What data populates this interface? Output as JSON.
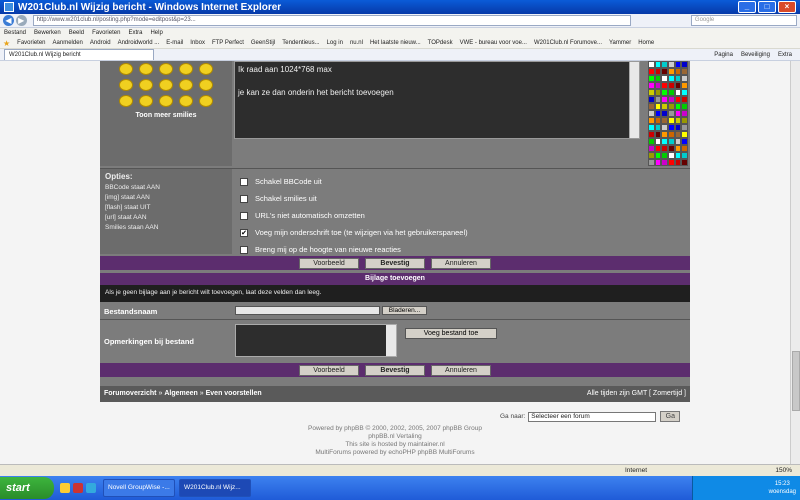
{
  "window": {
    "title": "W201Club.nl Wijzig bericht - Windows Internet Explorer"
  },
  "address": {
    "url": "http://www.w201club.nl/posting.php?mode=editpost&p=23...",
    "search_placeholder": "Google"
  },
  "menu": [
    "Bestand",
    "Bewerken",
    "Beeld",
    "Favorieten",
    "Extra",
    "Help"
  ],
  "favorites": [
    "Favorieten",
    "Aanmelden",
    "Android",
    "Androidworld ...",
    "E-mail",
    "Inbox",
    "FTP Perfect",
    "GeenStijl",
    "Tendentieus...",
    "Log in",
    "nu.nl",
    "Het laatste nieuw...",
    "TOPdesk",
    "VWE - bureau voor voe...",
    "W201Club.nl Forumove...",
    "Yammer",
    "Home"
  ],
  "tab": {
    "label": "W201Club.nl Wijzig bericht"
  },
  "tab_tools": [
    "Pagina",
    "Beveiliging",
    "Extra"
  ],
  "smilies": {
    "more_link": "Toon meer smilies"
  },
  "message": {
    "line1": "Ik raad aan 1024*768 max",
    "line2": "je kan ze dan onderin het bericht toevoegen"
  },
  "options": {
    "label": "Opties:",
    "bbcode": "BBCode staat AAN",
    "img": "[img] staat AAN",
    "flash": "[flash] staat UIT",
    "url": "[url] staat AAN",
    "smilies": "Smilies staan AAN",
    "checks": [
      {
        "label": "Schakel BBCode uit",
        "checked": false
      },
      {
        "label": "Schakel smilies uit",
        "checked": false
      },
      {
        "label": "URL's niet automatisch omzetten",
        "checked": false
      },
      {
        "label": "Voeg mijn onderschrift toe (te wijzigen via het gebruikerspaneel)",
        "checked": true
      },
      {
        "label": "Breng mij op de hoogte van nieuwe reacties",
        "checked": false
      }
    ]
  },
  "buttons": {
    "preview": "Voorbeeld",
    "submit": "Bevestig",
    "cancel": "Annuleren"
  },
  "attach": {
    "header": "Bijlage toevoegen",
    "note": "Als je geen bijlage aan je bericht wilt toevoegen, laat deze velden dan leeg.",
    "filename_label": "Bestandsnaam",
    "browse": "Bladeren...",
    "comment_label": "Opmerkingen bij bestand",
    "add_button": "Voeg bestand toe"
  },
  "breadcrumb": {
    "home": "Forumoverzicht",
    "sep": "»",
    "cat": "Algemeen",
    "forum": "Even voorstellen",
    "timezone": "Alle tijden zijn GMT [ Zomertijd ]"
  },
  "jump": {
    "label": "Ga naar:",
    "selected": "Selecteer een forum",
    "go": "Ga"
  },
  "footer": {
    "line1": "Powered by phpBB © 2000, 2002, 2005, 2007 phpBB Group",
    "line2": "phpBB.nl Vertaling",
    "line3": "This site is hosted by maintainer.nl",
    "line4": "MultiForums powered by echoPHP phpBB MultiForums"
  },
  "status": {
    "zone": "Internet",
    "zoom": "150%"
  },
  "taskbar": {
    "start": "start",
    "tasks": [
      "Novell GroupWise -...",
      "W201Club.nl Wijz..."
    ],
    "time": "15:23",
    "day": "woensdag"
  },
  "colors": {
    "forum_bg": "#7c7c7c",
    "accent_bar": "#5c2d6e"
  }
}
